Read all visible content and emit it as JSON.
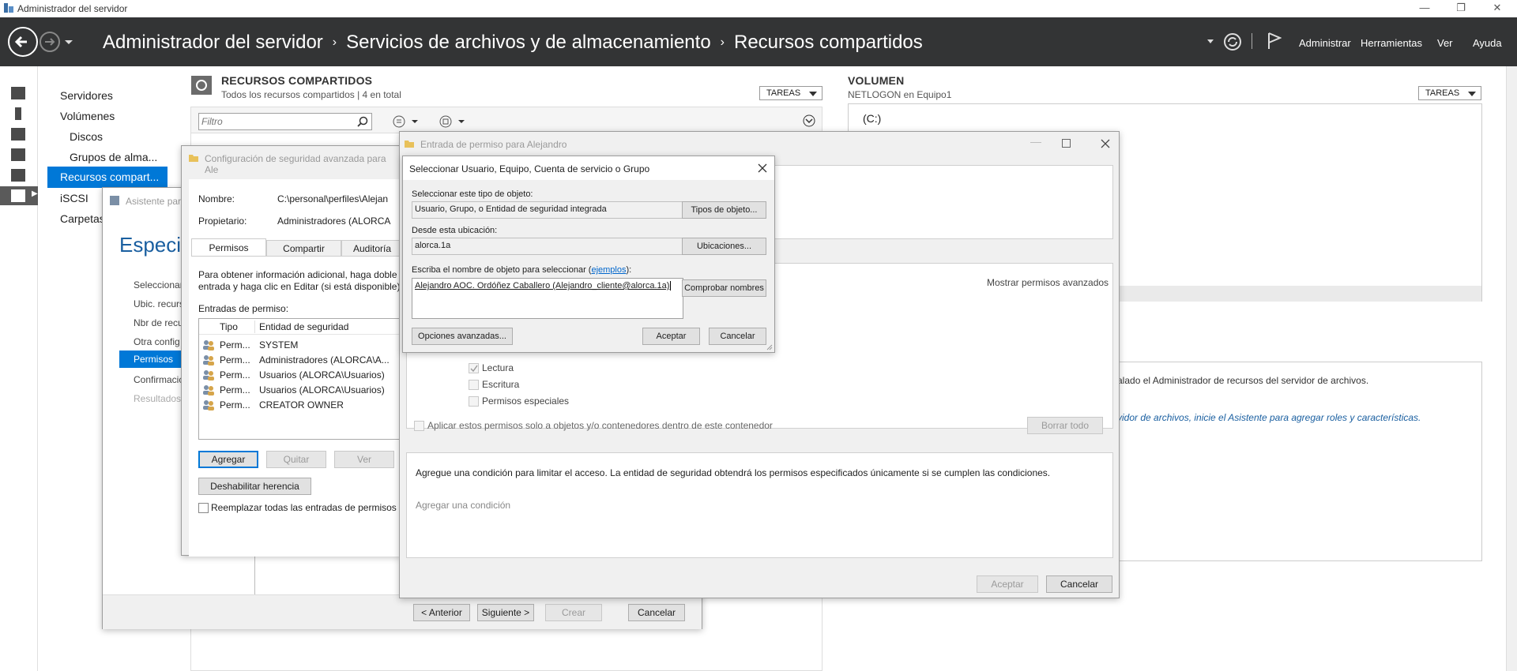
{
  "window": {
    "title": "Administrador del servidor",
    "controls": [
      "—",
      "❐",
      "✕"
    ]
  },
  "header": {
    "breadcrumb": [
      "Administrador del servidor",
      "Servicios de archivos y de almacenamiento",
      "Recursos compartidos"
    ],
    "menu": [
      "Administrar",
      "Herramientas",
      "Ver",
      "Ayuda"
    ]
  },
  "sidebar": {
    "items": [
      "Servidores",
      "Volúmenes",
      "Discos",
      "Grupos de alma...",
      "Recursos compart...",
      "iSCSI",
      "Carpetas"
    ]
  },
  "shares": {
    "title": "RECURSOS COMPARTIDOS",
    "subtitle": "Todos los recursos compartidos | 4 en total",
    "tasks": "TAREAS",
    "filter_placeholder": "Filtro"
  },
  "volume": {
    "title": "VOLUMEN",
    "subtitle": "NETLOGON en Equipo1",
    "tasks": "TAREAS",
    "drive": "(C:)",
    "fsrm_note": "alado el Administrador de recursos del servidor de archivos.",
    "fsrm_link": "vidor de archivos, inicie el Asistente para agregar roles y características."
  },
  "wizard": {
    "title": "Asistente para",
    "heading": "Especific",
    "steps": [
      "Seleccionar",
      "Ubic. recurs",
      "Nbr de recu",
      "Otra config",
      "Permisos",
      "Confirmacic",
      "Resultados"
    ],
    "prev": "< Anterior",
    "next": "Siguiente >",
    "create": "Crear",
    "cancel": "Cancelar"
  },
  "advsec": {
    "title": "Configuración de seguridad avanzada para Ale",
    "name_label": "Nombre:",
    "name_value": "C:\\personal\\perfiles\\Alejan",
    "owner_label": "Propietario:",
    "owner_value": "Administradores (ALORCA",
    "tabs": [
      "Permisos",
      "Compartir",
      "Auditoría"
    ],
    "info": [
      "Para obtener información adicional, haga doble",
      "entrada y haga clic en Editar (si está disponible)"
    ],
    "entries_label": "Entradas de permiso:",
    "col_type": "Tipo",
    "col_principal": "Entidad de seguridad",
    "rows": [
      {
        "type": "Perm...",
        "principal": "SYSTEM"
      },
      {
        "type": "Perm...",
        "principal": "Administradores (ALORCA\\A..."
      },
      {
        "type": "Perm...",
        "principal": "Usuarios (ALORCA\\Usuarios)"
      },
      {
        "type": "Perm...",
        "principal": "Usuarios (ALORCA\\Usuarios)"
      },
      {
        "type": "Perm...",
        "principal": "CREATOR OWNER"
      }
    ],
    "add": "Agregar",
    "remove": "Quitar",
    "view": "Ver",
    "disable_inherit": "Deshabilitar herencia",
    "replace": "Reemplazar todas las entradas de permisos d"
  },
  "permentry": {
    "title": "Entrada de permiso para Alejandro",
    "show_advanced": "Mostrar permisos avanzados",
    "perms": [
      "Lectura",
      "Escritura",
      "Permisos especiales"
    ],
    "apply_only": "Aplicar estos permisos solo a objetos y/o contenedores dentro de este contenedor",
    "clear_all": "Borrar todo",
    "condition_text": "Agregue una condición para limitar el acceso. La entidad de seguridad obtendrá los permisos especificados únicamente si se cumplen las condiciones.",
    "add_condition": "Agregar una condición",
    "ok": "Aceptar",
    "cancel": "Cancelar"
  },
  "select": {
    "title": "Seleccionar Usuario, Equipo, Cuenta de servicio o Grupo",
    "type_label": "Seleccionar este tipo de objeto:",
    "type_value": "Usuario, Grupo, o Entidad de seguridad integrada",
    "types_btn": "Tipos de objeto...",
    "loc_label": "Desde esta ubicación:",
    "loc_value": "alorca.1a",
    "loc_btn": "Ubicaciones...",
    "name_label_a": "Escriba el nombre de objeto para seleccionar (",
    "name_label_link": "ejemplos",
    "name_label_b": "):",
    "name_value": "Alejandro AOC. Ordóñez Caballero (Alejandro_cliente@alorca.1a)",
    "check_btn": "Comprobar nombres",
    "advanced_btn": "Opciones avanzadas...",
    "ok": "Aceptar",
    "cancel": "Cancelar"
  }
}
